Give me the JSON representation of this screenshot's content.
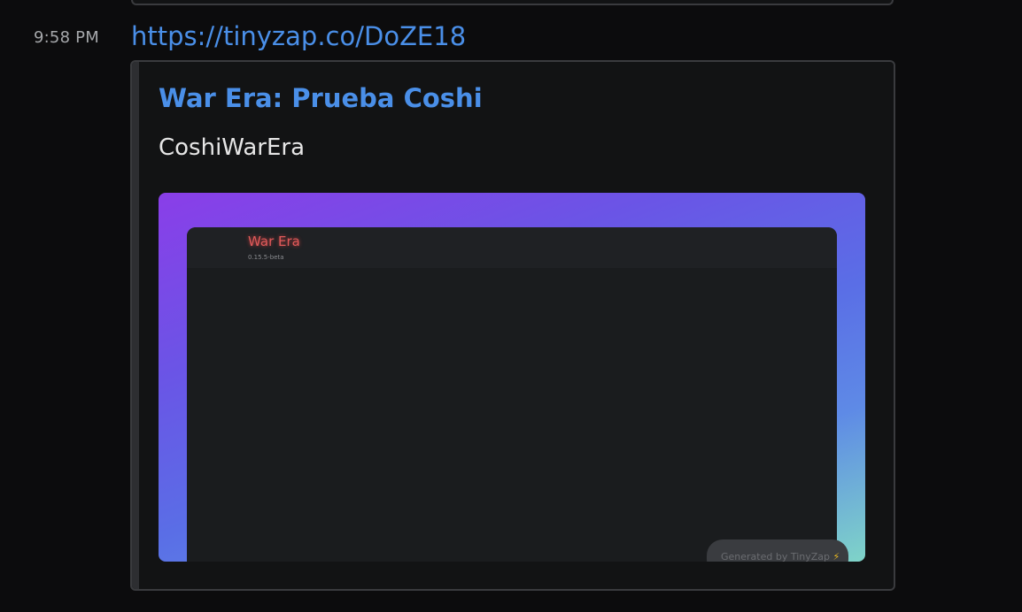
{
  "message": {
    "timestamp": "9:58 PM",
    "link_text": "https://tinyzap.co/DoZE18"
  },
  "embed": {
    "title": "War Era: Prueba Coshi",
    "description": "CoshiWarEra",
    "image": {
      "app_title": "War Era",
      "version": "0.15.5-beta",
      "badge_text": "Generated by TinyZap",
      "badge_icon": "lightning-bolt-icon"
    }
  },
  "colors": {
    "link": "#4a8fe8",
    "background": "#0c0c0d",
    "embed_background": "#121314",
    "embed_border": "#3a3b3e",
    "gradient_start": "#8a3ee8",
    "gradient_end": "#7fd4c8",
    "app_title_red": "#e05a5a"
  }
}
